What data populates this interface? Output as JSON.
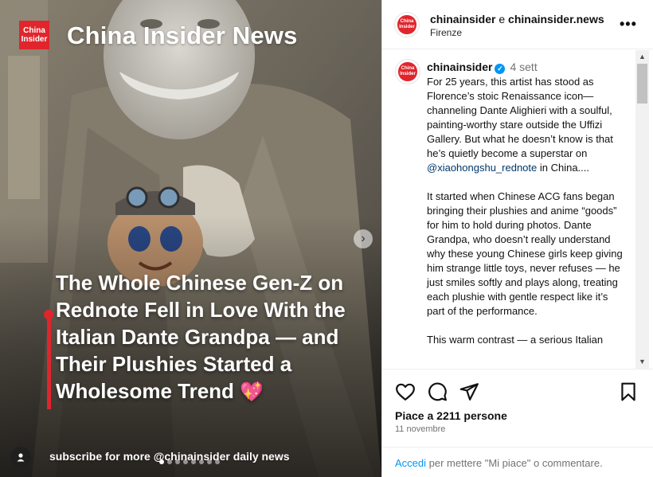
{
  "media": {
    "brand_logo_line1": "China",
    "brand_logo_line2": "Insider",
    "brand_title": "China Insider News",
    "headline": "The Whole Chinese Gen-Z on Rednote Fell in Love With the Italian Dante Grandpa — and Their Plushies Started a Wholesome Trend",
    "headline_emoji": "💖",
    "footer_cta": "subscribe for more @chinainsider daily news",
    "carousel": {
      "total": 8,
      "active_index": 0
    },
    "next_icon": "chevron-right-icon",
    "tag_icon": "user-tag-icon"
  },
  "header": {
    "author_primary": "chinainsider",
    "connector": " e ",
    "author_secondary": "chinainsider.news",
    "location": "Firenze",
    "more_icon": "more-horizontal-icon"
  },
  "caption": {
    "username": "chinainsider",
    "verified_icon": "verified-badge-icon",
    "time": "4 sett",
    "p1_before": "For 25 years, this artist has stood as Florence’s stoic Renaissance icon—channeling Dante Alighieri with a soulful, painting-worthy stare outside the Uffizi Gallery. But what he doesn’t know is that he’s quietly become a superstar on ",
    "p1_mention": "@xiaohongshu_rednote",
    "p1_after": " in China....",
    "p2": "It started when Chinese ACG fans began bringing their plushies and anime “goods” for him to hold during photos. Dante Grandpa, who doesn’t really understand why these young Chinese girls keep giving him strange little toys, never refuses — he just smiles softly and plays along, treating each plushie with gentle respect like it’s part of the performance.",
    "p3": "This warm contrast — a serious Italian"
  },
  "actions": {
    "like_icon": "heart-icon",
    "comment_icon": "comment-icon",
    "share_icon": "send-icon",
    "save_icon": "bookmark-icon",
    "likes_text": "Piace a 2211 persone",
    "date": "11 novembre",
    "login_link": "Accedi",
    "login_rest": " per mettere \"Mi piace\" o commentare."
  },
  "colors": {
    "brand_red": "#e0252c",
    "link_blue": "#0095f6",
    "mention_blue": "#00376b"
  }
}
